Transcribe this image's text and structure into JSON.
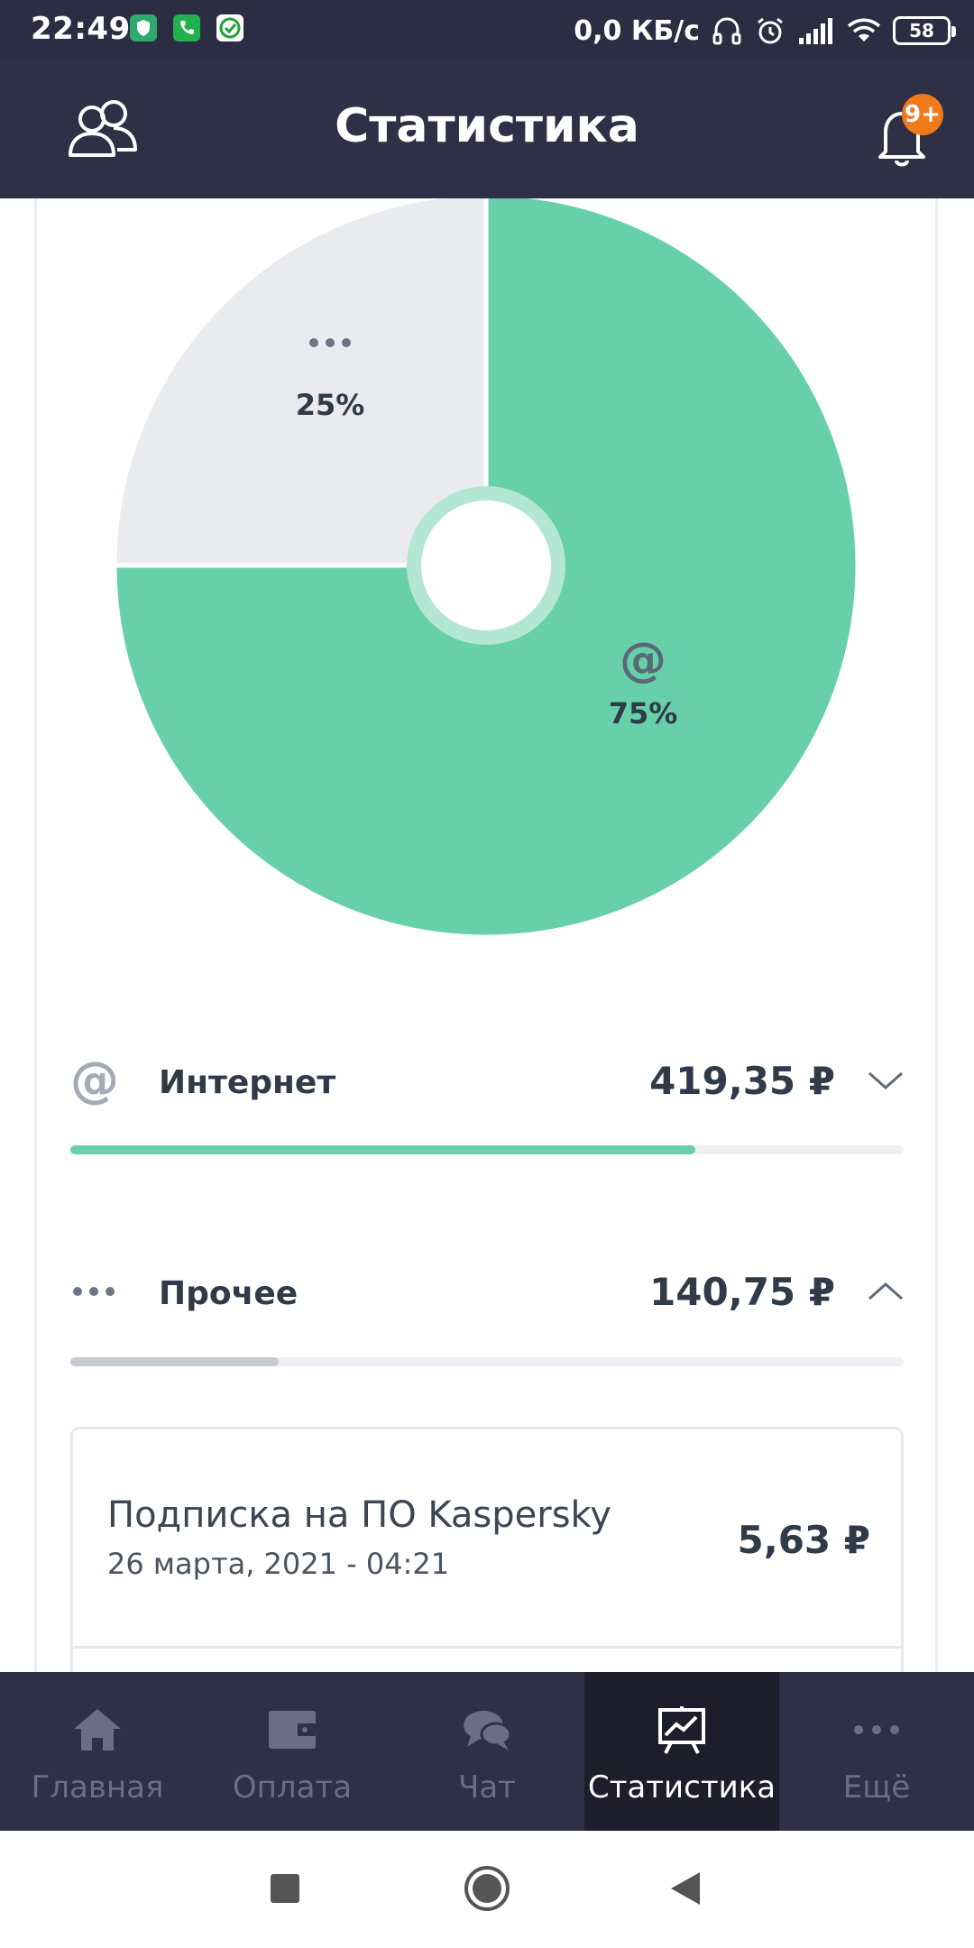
{
  "status_bar": {
    "time": "22:49",
    "net_speed": "0,0 КБ/с",
    "battery": "58",
    "icons": [
      "shield-app-icon",
      "phone-app-icon",
      "check-app-icon",
      "headphones-icon",
      "alarm-icon",
      "signal-icon",
      "wifi-icon",
      "battery-icon"
    ]
  },
  "header": {
    "title": "Статистика",
    "notification_badge": "9+"
  },
  "chart_data": {
    "type": "pie",
    "slices": [
      {
        "label": "@",
        "category": "Интернет",
        "percent": 75,
        "color": "#67d0aa"
      },
      {
        "label": "•••",
        "category": "Прочее",
        "percent": 25,
        "color": "#e9ebee"
      }
    ],
    "slice_labels": [
      "75%",
      "25%"
    ]
  },
  "categories": [
    {
      "name": "Интернет",
      "amount": "419,35 ₽",
      "share": 0.75,
      "color": "#67d0aa",
      "expanded": false,
      "icon": "at-sign-icon"
    },
    {
      "name": "Прочее",
      "amount": "140,75 ₽",
      "share": 0.25,
      "color": "#c6cbd3",
      "expanded": true,
      "icon": "more-dots-icon"
    }
  ],
  "transactions": [
    {
      "title": "Подписка на ПО Kaspersky",
      "date": "26 марта, 2021 - 04:21",
      "amount": "5,63 ₽"
    }
  ],
  "bottom_nav": [
    {
      "label": "Главная",
      "icon": "home-icon",
      "active": false
    },
    {
      "label": "Оплата",
      "icon": "wallet-icon",
      "active": false
    },
    {
      "label": "Чат",
      "icon": "chat-icon",
      "active": false
    },
    {
      "label": "Статистика",
      "icon": "chart-board-icon",
      "active": true
    },
    {
      "label": "Ещё",
      "icon": "more-dots-icon",
      "active": false
    }
  ]
}
